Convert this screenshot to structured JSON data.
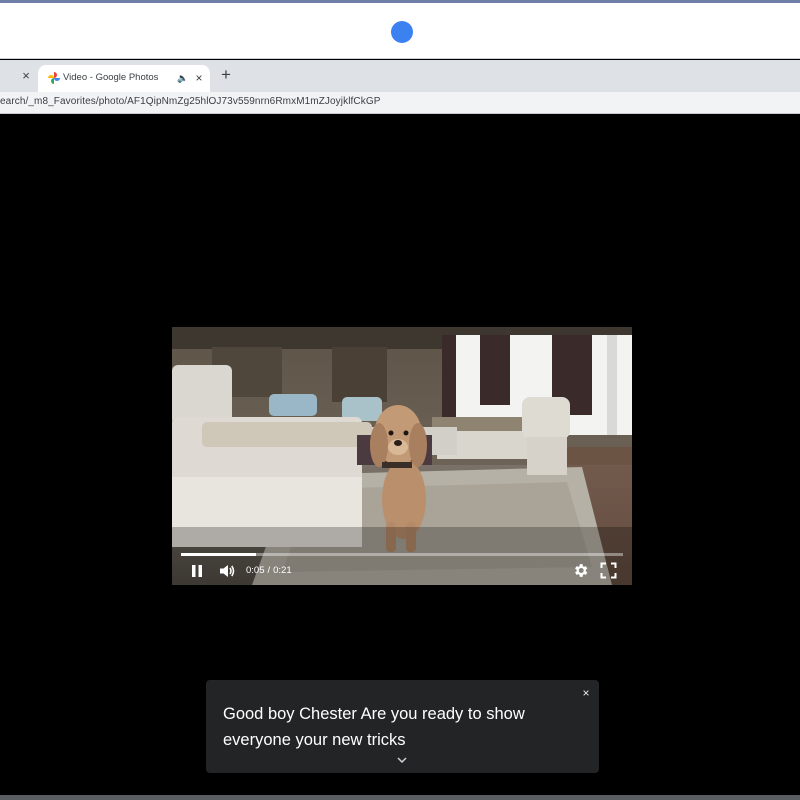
{
  "browser": {
    "tabs": [
      {
        "title": "Video - Google Photos",
        "favicon": "google-photos-pinwheel-icon",
        "audio": "speaker-icon"
      }
    ],
    "url": "earch/_m8_Favorites/photo/AF1QipNmZg25hlOJ73v559nrn6RmxM1mZJoyjklfCkGP",
    "icons": {
      "prev_tab_close": "×",
      "tab_close": "×",
      "new_tab": "+",
      "audio": "🔈"
    }
  },
  "player": {
    "current_time": "0:05",
    "duration": "0:21",
    "progress": 0.17,
    "state": "playing",
    "controls": [
      "pause-icon",
      "volume-icon",
      "gear-icon",
      "fullscreen-icon"
    ]
  },
  "caption": {
    "text": "Good boy Chester Are you ready to show everyone your new tricks",
    "close": "×"
  },
  "colors": {
    "accent_dot": "#3b82f0",
    "caption_bg": "#232426",
    "page_bg": "#000000"
  }
}
